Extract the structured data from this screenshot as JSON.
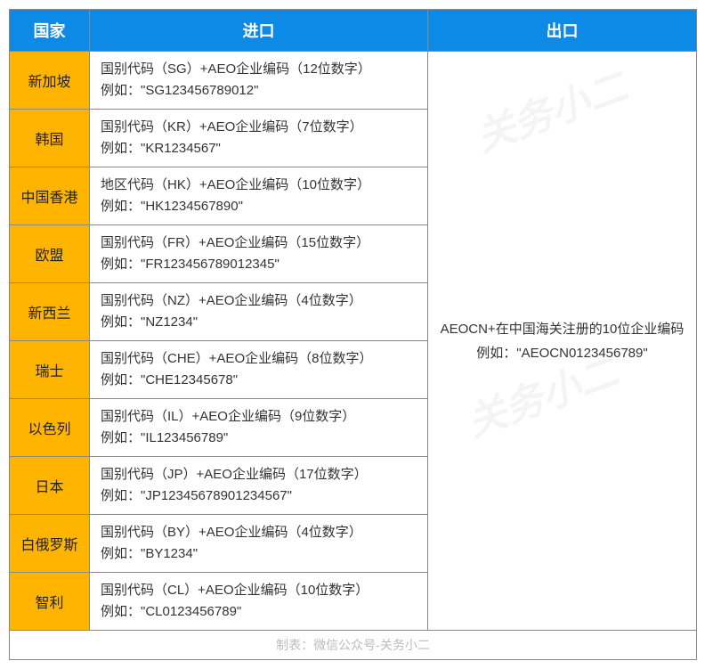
{
  "header": {
    "country": "国家",
    "import": "进口",
    "export": "出口"
  },
  "export_cell": {
    "line1": "AEOCN+在中国海关注册的10位企业编码",
    "line2": "例如：\"AEOCN0123456789\""
  },
  "rows": [
    {
      "country": "新加坡",
      "import_l1": "国别代码（SG）+AEO企业编码（12位数字）",
      "import_l2": "例如：\"SG123456789012\""
    },
    {
      "country": "韩国",
      "import_l1": "国别代码（KR）+AEO企业编码（7位数字）",
      "import_l2": "例如：\"KR1234567\""
    },
    {
      "country": "中国香港",
      "import_l1": "地区代码（HK）+AEO企业编码（10位数字）",
      "import_l2": "例如：\"HK1234567890\""
    },
    {
      "country": "欧盟",
      "import_l1": "国别代码（FR）+AEO企业编码（15位数字）",
      "import_l2": "例如：\"FR123456789012345\""
    },
    {
      "country": "新西兰",
      "import_l1": "国别代码（NZ）+AEO企业编码（4位数字）",
      "import_l2": "例如：\"NZ1234\""
    },
    {
      "country": "瑞士",
      "import_l1": "国别代码（CHE）+AEO企业编码（8位数字）",
      "import_l2": "例如：\"CHE12345678\""
    },
    {
      "country": "以色列",
      "import_l1": "国别代码（IL）+AEO企业编码（9位数字）",
      "import_l2": "例如：\"IL123456789\""
    },
    {
      "country": "日本",
      "import_l1": "国别代码（JP）+AEO企业编码（17位数字）",
      "import_l2": "例如：\"JP12345678901234567\""
    },
    {
      "country": "白俄罗斯",
      "import_l1": "国别代码（BY）+AEO企业编码（4位数字）",
      "import_l2": "例如：\"BY1234\""
    },
    {
      "country": "智利",
      "import_l1": "国别代码（CL）+AEO企业编码（10位数字）",
      "import_l2": "例如：\"CL0123456789\""
    }
  ],
  "footer": "制表：微信公众号-关务小二",
  "watermark": "关务小二"
}
